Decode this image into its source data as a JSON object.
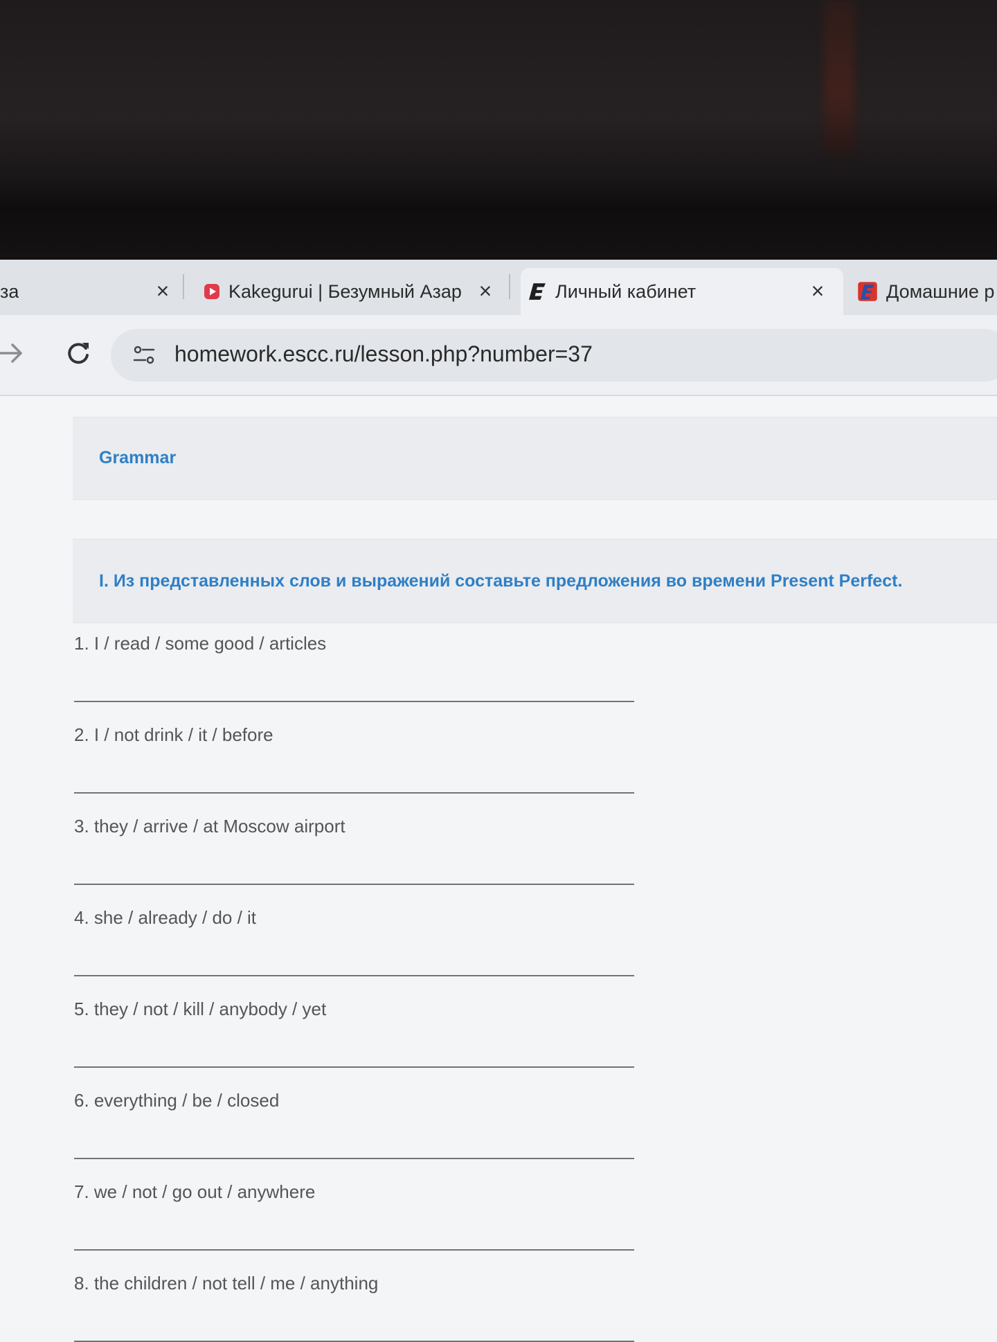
{
  "browser": {
    "tabs": [
      {
        "label": "за",
        "close_icon": "close-icon",
        "active": false
      },
      {
        "label": "Kakegurui | Безумный Азар",
        "favicon": "play-icon",
        "active": false
      },
      {
        "label": "Личный кабинет",
        "favicon": "e-logo-icon",
        "active": true
      },
      {
        "label": "Домашние р",
        "favicon": "homework-logo-icon",
        "active": false
      }
    ],
    "address": "homework.escc.ru/lesson.php?number=37",
    "colors": {
      "accent": "#2f7fc6",
      "play_icon": "#e03b4d"
    }
  },
  "page": {
    "section_title": "Grammar",
    "task_title": "I. Из представленных слов и выражений составьте предложения во времени Present Perfect.",
    "items": [
      {
        "prompt": "1. I / read / some good / articles",
        "answer": ""
      },
      {
        "prompt": "2. I / not drink / it / before",
        "answer": ""
      },
      {
        "prompt": "3. they / arrive / at Moscow airport",
        "answer": ""
      },
      {
        "prompt": "4. she / already / do / it",
        "answer": ""
      },
      {
        "prompt": "5. they / not / kill / anybody / yet",
        "answer": ""
      },
      {
        "prompt": "6. everything / be / closed",
        "answer": ""
      },
      {
        "prompt": "7. we / not / go out / anywhere",
        "answer": ""
      },
      {
        "prompt": "8. the children / not tell / me / anything",
        "answer": ""
      }
    ]
  }
}
